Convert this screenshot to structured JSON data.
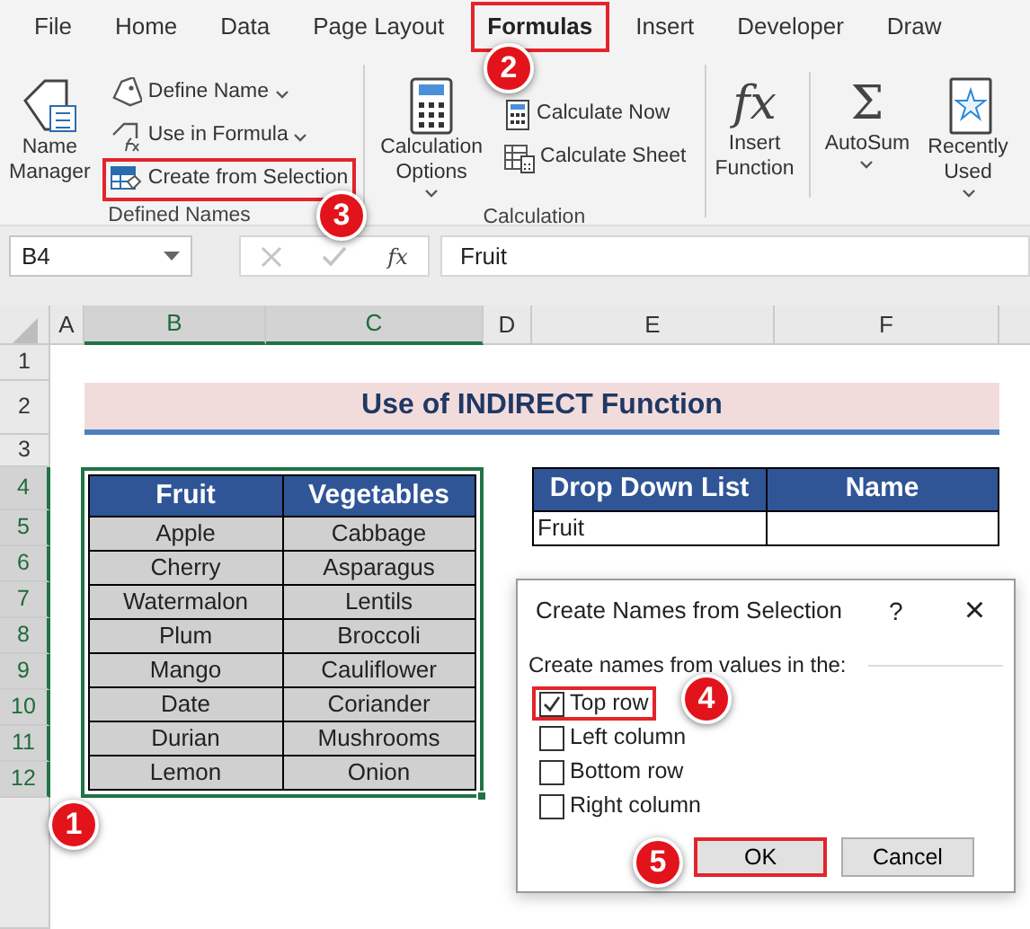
{
  "ribbon_tabs": [
    {
      "label": "File",
      "selected": false,
      "highlighted": false
    },
    {
      "label": "Home",
      "selected": false,
      "highlighted": false
    },
    {
      "label": "Data",
      "selected": false,
      "highlighted": false
    },
    {
      "label": "Page Layout",
      "selected": false,
      "highlighted": false
    },
    {
      "label": "Formulas",
      "selected": true,
      "highlighted": true
    },
    {
      "label": "Insert",
      "selected": false,
      "highlighted": false
    },
    {
      "label": "Developer",
      "selected": false,
      "highlighted": false
    },
    {
      "label": "Draw",
      "selected": false,
      "highlighted": false
    }
  ],
  "ribbon_groups": [
    {
      "label": "Defined Names",
      "items": [
        {
          "kind": "large",
          "lines": [
            "Name",
            "Manager"
          ],
          "dropdown": false,
          "highlighted": false
        },
        {
          "kind": "small",
          "label": "Define Name",
          "dropdown": true,
          "highlighted": false
        },
        {
          "kind": "small",
          "label": "Use in Formula",
          "dropdown": true,
          "highlighted": false
        },
        {
          "kind": "small",
          "label": "Create from Selection",
          "dropdown": false,
          "highlighted": true
        }
      ]
    },
    {
      "label": "Calculation",
      "items": [
        {
          "kind": "large",
          "lines": [
            "Calculation",
            "Options"
          ],
          "dropdown": true,
          "highlighted": false
        },
        {
          "kind": "small",
          "label": "Calculate Now",
          "dropdown": false,
          "highlighted": false
        },
        {
          "kind": "small",
          "label": "Calculate Sheet",
          "dropdown": false,
          "highlighted": false
        }
      ]
    },
    {
      "items": [
        {
          "kind": "large",
          "symbol": "fx",
          "lines": [
            "Insert",
            "Function"
          ],
          "dropdown": false,
          "highlighted": false
        },
        {
          "kind": "large",
          "symbol": "Σ",
          "lines": [
            "AutoSum"
          ],
          "dropdown": true,
          "highlighted": false
        },
        {
          "kind": "large",
          "lines": [
            "Recently",
            "Used"
          ],
          "dropdown": true,
          "highlighted": false
        }
      ]
    }
  ],
  "formula_bar": {
    "name_box": "B4",
    "function_symbol": "fx",
    "value": "Fruit"
  },
  "columns": [
    {
      "label": "A",
      "selected": false
    },
    {
      "label": "B",
      "selected": true
    },
    {
      "label": "C",
      "selected": true
    },
    {
      "label": "D",
      "selected": false
    },
    {
      "label": "E",
      "selected": false
    },
    {
      "label": "F",
      "selected": false
    }
  ],
  "rows": [
    {
      "label": "1",
      "selected": false
    },
    {
      "label": "2",
      "selected": false
    },
    {
      "label": "3",
      "selected": false
    },
    {
      "label": "4",
      "selected": true
    },
    {
      "label": "5",
      "selected": true
    },
    {
      "label": "6",
      "selected": true
    },
    {
      "label": "7",
      "selected": true
    },
    {
      "label": "8",
      "selected": true
    },
    {
      "label": "9",
      "selected": true
    },
    {
      "label": "10",
      "selected": true
    },
    {
      "label": "11",
      "selected": true
    },
    {
      "label": "12",
      "selected": true
    }
  ],
  "sheet_title": "Use of INDIRECT Function",
  "produce_table": {
    "columns": [
      "Fruit",
      "Vegetables"
    ],
    "rows": [
      [
        "Apple",
        "Cabbage"
      ],
      [
        "Cherry",
        "Asparagus"
      ],
      [
        "Watermalon",
        "Lentils"
      ],
      [
        "Plum",
        "Broccoli"
      ],
      [
        "Mango",
        "Cauliflower"
      ],
      [
        "Date",
        "Coriander"
      ],
      [
        "Durian",
        "Mushrooms"
      ],
      [
        "Lemon",
        "Onion"
      ]
    ]
  },
  "dropdown_table": {
    "columns": [
      "Drop Down List",
      "Name"
    ],
    "rows": [
      [
        "Fruit"
      ]
    ]
  },
  "dialog": {
    "title": "Create Names from Selection",
    "help": "?",
    "close": "×",
    "group_label": "Create names from values in the:",
    "options": [
      {
        "label": "Top row",
        "checked": true,
        "highlighted": true
      },
      {
        "label": "Left column",
        "checked": false,
        "highlighted": false
      },
      {
        "label": "Bottom row",
        "checked": false,
        "highlighted": false
      },
      {
        "label": "Right column",
        "checked": false,
        "highlighted": false
      }
    ],
    "buttons": [
      {
        "label": "OK",
        "highlighted": true
      },
      {
        "label": "Cancel",
        "highlighted": false
      }
    ]
  },
  "callouts": [
    {
      "label": "1"
    },
    {
      "label": "2"
    },
    {
      "label": "3"
    },
    {
      "label": "4"
    },
    {
      "label": "5"
    }
  ]
}
